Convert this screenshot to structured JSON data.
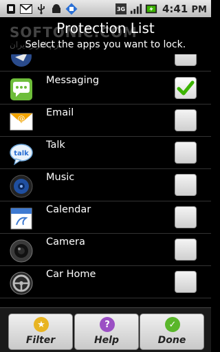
{
  "status_bar": {
    "left_icons": [
      "usb-icon",
      "gmail-icon",
      "usb-debug-icon",
      "android-icon",
      "download-icon"
    ],
    "network_label": "3G",
    "time": "4:41",
    "time_suffix": "PM"
  },
  "header": {
    "title": "Protection List",
    "subtitle": "Select the apps you want to lock."
  },
  "watermark": {
    "text": "SOFTONIC.COM",
    "subtext": "نرم افزار ایران"
  },
  "apps": [
    {
      "label": "",
      "icon": "maps-icon",
      "checked": false
    },
    {
      "label": "Messaging",
      "icon": "messaging-icon",
      "checked": true
    },
    {
      "label": "Email",
      "icon": "email-icon",
      "checked": false
    },
    {
      "label": "Talk",
      "icon": "talk-icon",
      "checked": false
    },
    {
      "label": "Music",
      "icon": "music-icon",
      "checked": false
    },
    {
      "label": "Calendar",
      "icon": "calendar-icon",
      "checked": false
    },
    {
      "label": "Camera",
      "icon": "camera-icon",
      "checked": false
    },
    {
      "label": "Car Home",
      "icon": "car-home-icon",
      "checked": false
    }
  ],
  "toolbar": {
    "filter_label": "Filter",
    "help_label": "Help",
    "done_label": "Done"
  },
  "colors": {
    "checkmark": "#3cb400",
    "filter_icon": "#e8b422",
    "help_icon": "#9b4fc4",
    "done_icon": "#59b62a"
  }
}
